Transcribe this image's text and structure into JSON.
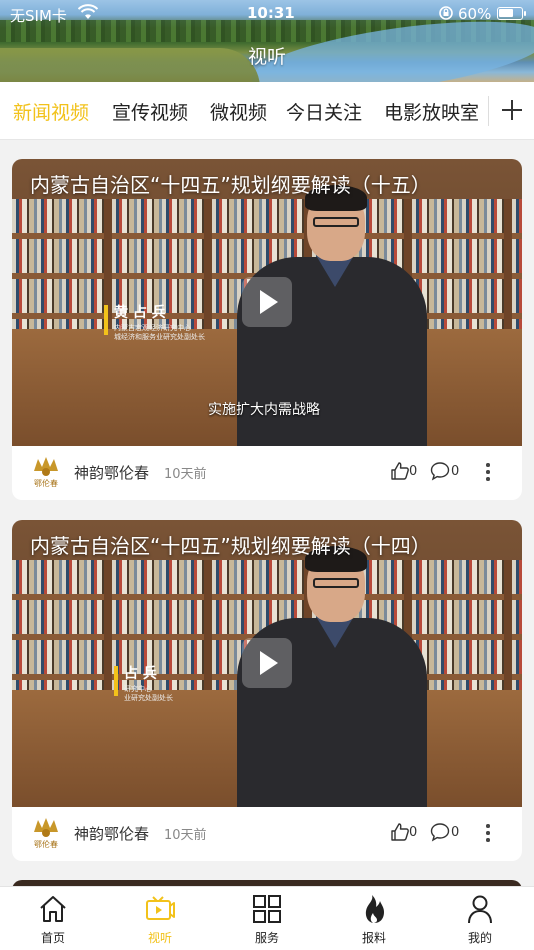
{
  "status_bar": {
    "carrier": "无SIM卡",
    "time": "10:31",
    "battery": "60%",
    "battery_level": 0.6
  },
  "header": {
    "title": "视听"
  },
  "tabs": [
    {
      "label": "新闻视频",
      "active": true
    },
    {
      "label": "宣传视频"
    },
    {
      "label": "微视频"
    },
    {
      "label": "今日关注"
    },
    {
      "label": "电影放映室"
    }
  ],
  "feed": [
    {
      "title": "内蒙古自治区“十四五”规划纲要解读（十五）",
      "nameplate": {
        "name": "黄 占 兵",
        "line1": "内蒙古宏观经济研究中心",
        "line2": "城经济和服务业研究处副处长"
      },
      "subtitle": "实施扩大内需战略",
      "author": "神韵鄂伦春",
      "time_ago": "10天前",
      "likes": "0",
      "comments": "0"
    },
    {
      "title": "内蒙古自治区“十四五”规划纲要解读（十四）",
      "nameplate": {
        "name": "占 兵",
        "line1": "研究中心",
        "line2": "业研究处副处长"
      },
      "subtitle": "",
      "author": "神韵鄂伦春",
      "time_ago": "10天前",
      "likes": "0",
      "comments": "0"
    }
  ],
  "bottom_nav": [
    {
      "label": "首页",
      "icon": "home-icon"
    },
    {
      "label": "视听",
      "icon": "tv-play-icon",
      "active": true
    },
    {
      "label": "服务",
      "icon": "grid-icon"
    },
    {
      "label": "报料",
      "icon": "flame-icon"
    },
    {
      "label": "我的",
      "icon": "person-icon"
    }
  ],
  "colors": {
    "accent": "#f2c21b"
  }
}
